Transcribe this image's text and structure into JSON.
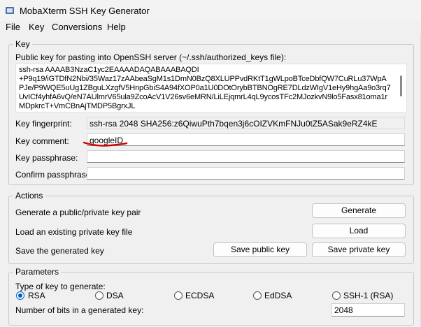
{
  "window": {
    "title": "MobaXterm SSH Key Generator"
  },
  "menu": {
    "items": [
      "File",
      "Key",
      "Conversions",
      "Help"
    ]
  },
  "key_section": {
    "title": "Key",
    "pubkey_label": "Public key for pasting into OpenSSH server (~/.ssh/authorized_keys file):",
    "pubkey_lines": [
      "ssh-rsa AAAAB3NzaC1yc2EAAAADAQABAAABAQDI",
      "+P9q19/iGTDfN2Nbi/35Waz17zAAbeaSgM1s1DmN0BzQ8XLUPPvdRKtT1gWLpoBTceDbfQW7CuRLu37WpA",
      "PJe/P9WQE5uUg1ZBguLXzgfV5HnpGbiS4A94fXOP0a1U0DOtOrybBTBNOgRE7DLdzWIgV1eHy9hgAa9o3rq7",
      "UvICf4yhfA6vQ/eN7AUlmrV65ula9ZcoAcV1V26sv6eMRN/LiLEjqmrL4qL9ycosTFc2MJozkvN9lo5Fasx81oma1r",
      "MDpkrcT+VmCBnAjTMDP5BgrxJL"
    ],
    "fingerprint_label": "Key fingerprint:",
    "fingerprint_value": "ssh-rsa 2048 SHA256:z6QiwuPth7bqen3j6cOIZVKmFNJu0tZ5ASak9eRZ4kE",
    "comment_label": "Key comment:",
    "comment_value": "googleID",
    "passphrase_label": "Key passphrase:",
    "passphrase_value": "",
    "confirm_label": "Confirm passphrase:",
    "confirm_value": ""
  },
  "actions_section": {
    "title": "Actions",
    "generate_text": "Generate a public/private key pair",
    "generate_button": "Generate",
    "load_text": "Load an existing private key file",
    "load_button": "Load",
    "save_text": "Save the generated key",
    "save_public_button": "Save public key",
    "save_private_button": "Save private key"
  },
  "parameters_section": {
    "title": "Parameters",
    "type_label": "Type of key to generate:",
    "key_types": [
      {
        "label": "RSA",
        "checked": true
      },
      {
        "label": "DSA",
        "checked": false
      },
      {
        "label": "ECDSA",
        "checked": false
      },
      {
        "label": "EdDSA",
        "checked": false
      },
      {
        "label": "SSH-1 (RSA)",
        "checked": false
      }
    ],
    "bits_label": "Number of bits in a generated key:",
    "bits_value": "2048"
  },
  "colors": {
    "accent": "#0060c0",
    "annotation_red": "#d00000"
  }
}
